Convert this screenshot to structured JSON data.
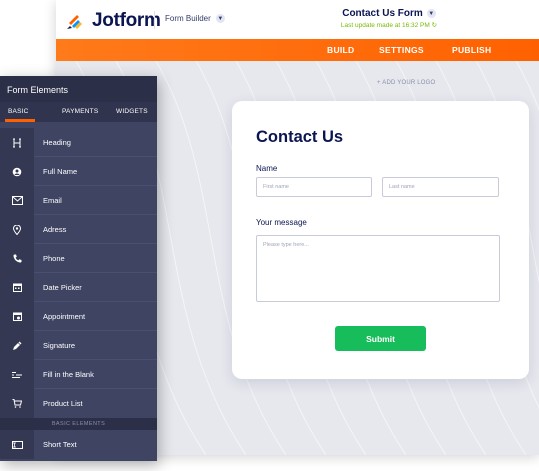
{
  "header": {
    "brand": "Jotform",
    "builder_label": "Form Builder",
    "form_title": "Contact Us Form",
    "last_update": "Last update made at 16:32 PM",
    "tabs": [
      "BUILD",
      "SETTINGS",
      "PUBLISH"
    ]
  },
  "canvas": {
    "add_logo": "+ ADD YOUR LOGO"
  },
  "form": {
    "title": "Contact Us",
    "name_label": "Name",
    "first_placeholder": "First name",
    "last_placeholder": "Last name",
    "message_label": "Your message",
    "message_placeholder": "Please type here...",
    "submit_label": "Submit"
  },
  "panel": {
    "title": "Form Elements",
    "tabs": [
      "BASIC",
      "PAYMENTS",
      "WIDGETS"
    ],
    "items": [
      {
        "label": "Heading",
        "icon": "heading-icon"
      },
      {
        "label": "Full Name",
        "icon": "user-icon"
      },
      {
        "label": "Email",
        "icon": "envelope-icon"
      },
      {
        "label": "Adress",
        "icon": "location-pin-icon"
      },
      {
        "label": "Phone",
        "icon": "phone-icon"
      },
      {
        "label": "Date Picker",
        "icon": "calendar-icon"
      },
      {
        "label": "Appointment",
        "icon": "appointment-calendar-icon"
      },
      {
        "label": "Signature",
        "icon": "pen-icon"
      },
      {
        "label": "Fill in the Blank",
        "icon": "fill-blank-icon"
      },
      {
        "label": "Product List",
        "icon": "cart-icon"
      }
    ],
    "section_label": "BASIC ELEMENTS",
    "extra_item": {
      "label": "Short Text",
      "icon": "short-text-icon"
    }
  },
  "colors": {
    "orange": "#ff6100",
    "navy": "#0a1551",
    "green": "#18bd5b",
    "panel": "#3f4463"
  }
}
